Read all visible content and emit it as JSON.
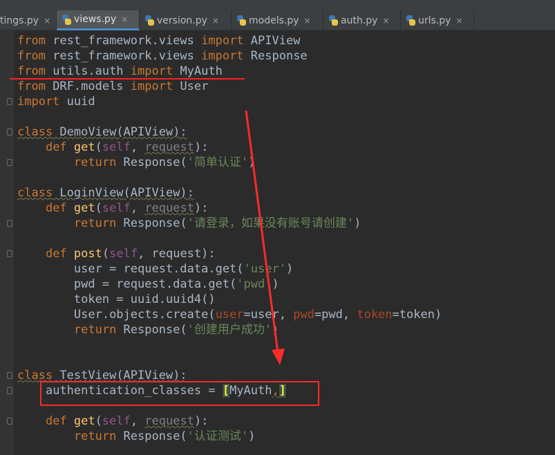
{
  "tabs": [
    {
      "label": "tings.py",
      "active": false
    },
    {
      "label": "views.py",
      "active": true
    },
    {
      "label": "version.py",
      "active": false
    },
    {
      "label": "models.py",
      "active": false
    },
    {
      "label": "auth.py",
      "active": false
    },
    {
      "label": "urls.py",
      "active": false
    }
  ],
  "close_glyph": "×",
  "colors": {
    "background": "#2b2b2b",
    "keyword": "#cc7832",
    "string": "#6a8759",
    "function": "#ffc66d",
    "self": "#94558d",
    "param": "#aa4926",
    "annotation": "#ff2a2a"
  },
  "code": {
    "l1": {
      "kw1": "from",
      "t1": " rest_framework.views ",
      "kw2": "import",
      "t2": " APIView"
    },
    "l2": {
      "kw1": "from",
      "t1": " rest_framework.views ",
      "kw2": "import",
      "t2": " Response"
    },
    "l3": {
      "kw1": "from",
      "t1": " utils.auth ",
      "kw2": "import",
      "t2": " MyAuth"
    },
    "l4": {
      "kw1": "from",
      "t1": " DRF.models ",
      "kw2": "import",
      "t2": " User"
    },
    "l5": {
      "kw1": "import",
      "t1": " uuid"
    },
    "l7": {
      "kw1": "class",
      "name": " DemoView",
      "t1": "(APIView):"
    },
    "l8": {
      "indent": "    ",
      "kw1": "def",
      "fn": " get",
      "p1": "(",
      "self": "self",
      "p2": ", ",
      "arg": "request",
      "p3": "):"
    },
    "l9": {
      "indent": "        ",
      "kw1": "return",
      "t1": " Response(",
      "str": "'简单认证'",
      "t2": ")"
    },
    "l11": {
      "kw1": "class",
      "name": " LoginView",
      "t1": "(APIView):"
    },
    "l12": {
      "indent": "    ",
      "kw1": "def",
      "fn": " get",
      "p1": "(",
      "self": "self",
      "p2": ", ",
      "arg": "request",
      "p3": "):"
    },
    "l13": {
      "indent": "        ",
      "kw1": "return",
      "t1": " Response(",
      "str": "'请登录，如果没有账号请创建'",
      "t2": ")"
    },
    "l15": {
      "indent": "    ",
      "kw1": "def",
      "fn": " post",
      "p1": "(",
      "self": "self",
      "p2": ", request):"
    },
    "l16": {
      "indent": "        ",
      "t1": "user = request.data.get(",
      "str": "'user'",
      "t2": ")"
    },
    "l17": {
      "indent": "        ",
      "t1": "pwd = request.data.get(",
      "str": "'pwd'",
      "t2": ")"
    },
    "l18": {
      "indent": "        ",
      "t1": "token = uuid.uuid4()"
    },
    "l19": {
      "indent": "        ",
      "t1": "User.objects.create(",
      "a1": "user",
      "t2": "=user, ",
      "a2": "pwd",
      "t3": "=pwd, ",
      "a3": "token",
      "t4": "=token)"
    },
    "l20": {
      "indent": "        ",
      "kw1": "return",
      "t1": " Response(",
      "str": "'创建用户成功'",
      "t2": ")"
    },
    "l23": {
      "kw1": "class",
      "name": " TestView",
      "t1": "(APIView):"
    },
    "l24": {
      "indent": "    ",
      "t1": "authentication_classes = ",
      "b1": "[",
      "t2": "MyAuth",
      "c": ",",
      "b2": "]"
    },
    "l26": {
      "indent": "    ",
      "kw1": "def",
      "fn": " get",
      "p1": "(",
      "self": "self",
      "p2": ", ",
      "arg": "request",
      "p3": "):"
    },
    "l27": {
      "indent": "        ",
      "kw1": "return",
      "t1": " Response(",
      "str": "'认证测试'",
      "t2": ")"
    }
  }
}
